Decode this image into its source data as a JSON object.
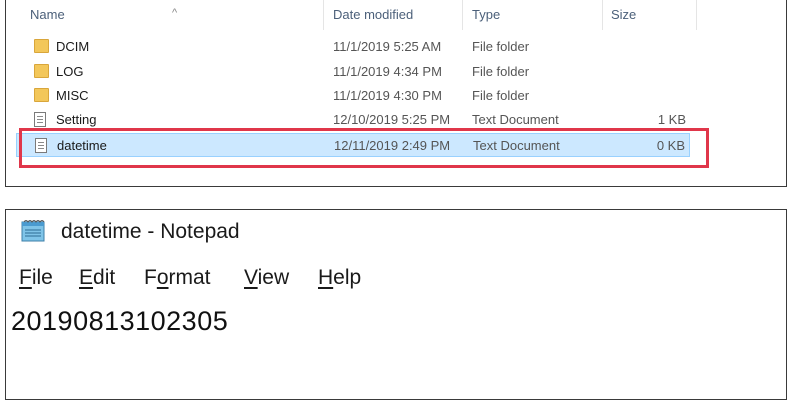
{
  "explorer": {
    "columns": {
      "name": "Name",
      "date_modified": "Date modified",
      "type": "Type",
      "size": "Size"
    },
    "rows": [
      {
        "name": "DCIM",
        "date": "11/1/2019 5:25 AM",
        "type": "File folder",
        "size": "",
        "icon": "folder-icon"
      },
      {
        "name": "LOG",
        "date": "11/1/2019 4:34 PM",
        "type": "File folder",
        "size": "",
        "icon": "folder-icon"
      },
      {
        "name": "MISC",
        "date": "11/1/2019 4:30 PM",
        "type": "File folder",
        "size": "",
        "icon": "folder-icon"
      },
      {
        "name": "Setting",
        "date": "12/10/2019 5:25 PM",
        "type": "Text Document",
        "size": "1 KB",
        "icon": "text-document-icon"
      },
      {
        "name": "datetime",
        "date": "12/11/2019 2:49 PM",
        "type": "Text Document",
        "size": "0 KB",
        "icon": "text-document-icon",
        "selected": true
      }
    ],
    "highlight_color": "#e0364a",
    "selection_color": "#cce8ff"
  },
  "notepad": {
    "title": "datetime - Notepad",
    "menu": {
      "file": {
        "first": "F",
        "rest": "ile"
      },
      "edit": {
        "first": "E",
        "rest": "dit"
      },
      "format": {
        "pre": "F",
        "under": "o",
        "rest": "rmat"
      },
      "view": {
        "first": "V",
        "rest": "iew"
      },
      "help": {
        "first": "H",
        "rest": "elp"
      }
    },
    "content": "20190813102305"
  }
}
